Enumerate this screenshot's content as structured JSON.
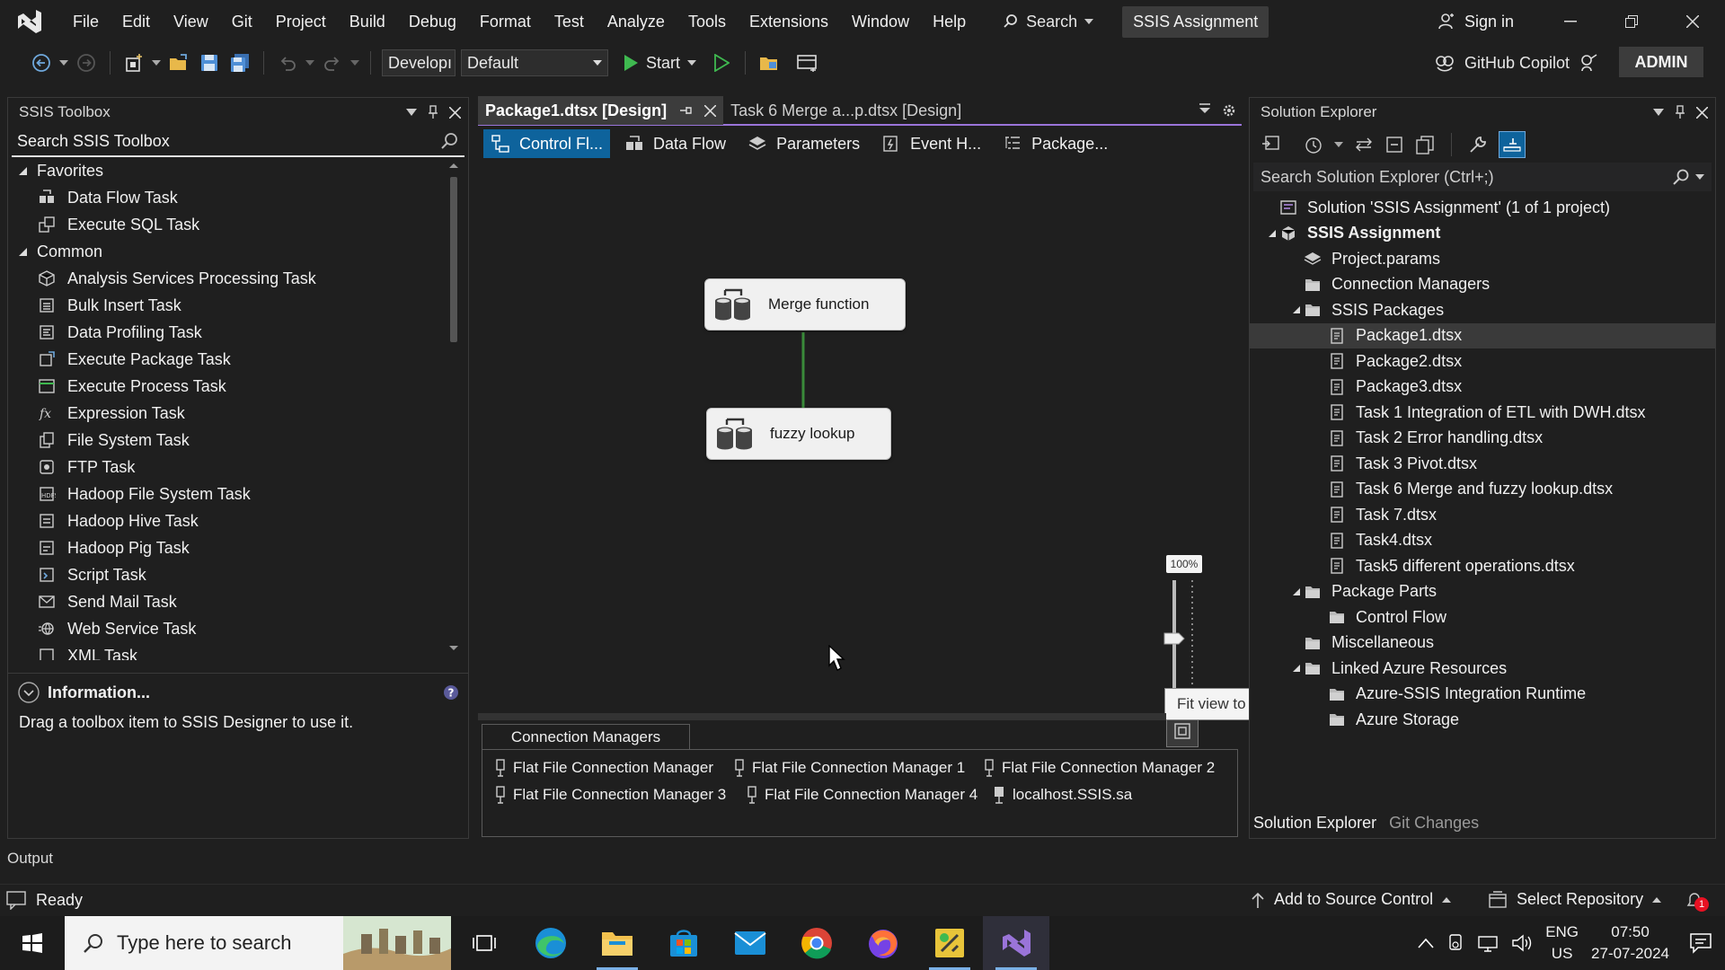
{
  "menubar": {
    "items": [
      "File",
      "Edit",
      "View",
      "Git",
      "Project",
      "Build",
      "Debug",
      "Format",
      "Test",
      "Analyze",
      "Tools",
      "Extensions",
      "Window",
      "Help"
    ],
    "search_label": "Search",
    "solution_name": "SSIS Assignment",
    "sign_in": "Sign in"
  },
  "toolbar": {
    "config_combo": "Developı",
    "platform_combo": "Default",
    "start_label": "Start",
    "copilot_label": "GitHub Copilot",
    "admin_label": "ADMIN"
  },
  "toolbox": {
    "title": "SSIS Toolbox",
    "search_placeholder": "Search SSIS Toolbox",
    "groups": [
      {
        "name": "Favorites",
        "items": [
          "Data Flow Task",
          "Execute SQL Task"
        ]
      },
      {
        "name": "Common",
        "items": [
          "Analysis Services Processing Task",
          "Bulk Insert Task",
          "Data Profiling Task",
          "Execute Package Task",
          "Execute Process Task",
          "Expression Task",
          "File System Task",
          "FTP Task",
          "Hadoop File System Task",
          "Hadoop Hive Task",
          "Hadoop Pig Task",
          "Script Task",
          "Send Mail Task",
          "Web Service Task",
          "XML Task"
        ]
      }
    ],
    "info_title": "Information...",
    "info_text": "Drag a toolbox item to SSIS Designer to use it."
  },
  "designer": {
    "tabs": [
      {
        "label": "Package1.dtsx [Design]",
        "active": true
      },
      {
        "label": "Task 6 Merge a...p.dtsx [Design]",
        "active": false
      }
    ],
    "designer_tabs": [
      "Control Fl...",
      "Data Flow",
      "Parameters",
      "Event H...",
      "Package..."
    ],
    "tasks": [
      {
        "label": "Merge function"
      },
      {
        "label": "fuzzy lookup"
      }
    ],
    "zoom_label": "100%",
    "zoom_level": 0.5,
    "tooltip": "Fit view to window",
    "connection_managers_title": "Connection Managers",
    "connection_managers": [
      "Flat File Connection Manager",
      "Flat File Connection Manager 1",
      "Flat File Connection Manager 2",
      "Flat File Connection Manager 3",
      "Flat File Connection Manager 4",
      "localhost.SSIS.sa"
    ]
  },
  "solution_explorer": {
    "title": "Solution Explorer",
    "search_placeholder": "Search Solution Explorer (Ctrl+;)",
    "tree": [
      {
        "label": "Solution 'SSIS Assignment' (1 of 1 project)",
        "level": 0,
        "icon": "solution-icon"
      },
      {
        "label": "SSIS Assignment",
        "level": 0,
        "icon": "project-icon",
        "expanded": true,
        "bold": true
      },
      {
        "label": "Project.params",
        "level": 1,
        "icon": "params-icon"
      },
      {
        "label": "Connection Managers",
        "level": 1,
        "icon": "folder-icon"
      },
      {
        "label": "SSIS Packages",
        "level": 1,
        "icon": "folder-icon",
        "expanded": true
      },
      {
        "label": "Package1.dtsx",
        "level": 2,
        "icon": "package-icon",
        "selected": true
      },
      {
        "label": "Package2.dtsx",
        "level": 2,
        "icon": "package-icon"
      },
      {
        "label": "Package3.dtsx",
        "level": 2,
        "icon": "package-icon"
      },
      {
        "label": "Task 1 Integration of ETL with DWH.dtsx",
        "level": 2,
        "icon": "package-icon"
      },
      {
        "label": "Task 2 Error handling.dtsx",
        "level": 2,
        "icon": "package-icon"
      },
      {
        "label": "Task 3 Pivot.dtsx",
        "level": 2,
        "icon": "package-icon"
      },
      {
        "label": "Task 6 Merge and fuzzy lookup.dtsx",
        "level": 2,
        "icon": "package-icon"
      },
      {
        "label": "Task 7.dtsx",
        "level": 2,
        "icon": "package-icon"
      },
      {
        "label": "Task4.dtsx",
        "level": 2,
        "icon": "package-icon"
      },
      {
        "label": "Task5 different operations.dtsx",
        "level": 2,
        "icon": "package-icon"
      },
      {
        "label": "Package Parts",
        "level": 1,
        "icon": "folder-icon",
        "expanded": true
      },
      {
        "label": "Control Flow",
        "level": 2,
        "icon": "folder-icon"
      },
      {
        "label": "Miscellaneous",
        "level": 1,
        "icon": "folder-icon"
      },
      {
        "label": "Linked Azure Resources",
        "level": 1,
        "icon": "folder-icon",
        "expanded": true
      },
      {
        "label": "Azure-SSIS Integration Runtime",
        "level": 2,
        "icon": "folder-icon"
      },
      {
        "label": "Azure Storage",
        "level": 2,
        "icon": "folder-icon"
      }
    ],
    "bottom_tabs": [
      "Solution Explorer",
      "Git Changes"
    ]
  },
  "output": {
    "label": "Output"
  },
  "statusbar": {
    "ready": "Ready",
    "add_to_source": "Add to Source Control",
    "select_repo": "Select Repository",
    "notification_count": "1"
  },
  "taskbar": {
    "search_placeholder": "Type here to search",
    "lang_top": "ENG",
    "lang_bottom": "US",
    "time": "07:50",
    "date": "27-07-2024"
  },
  "colors": {
    "accent": "#9a74d9",
    "active_tab": "#0e639c",
    "run_green": "#3fb950",
    "connector": "#3a8a3a"
  }
}
